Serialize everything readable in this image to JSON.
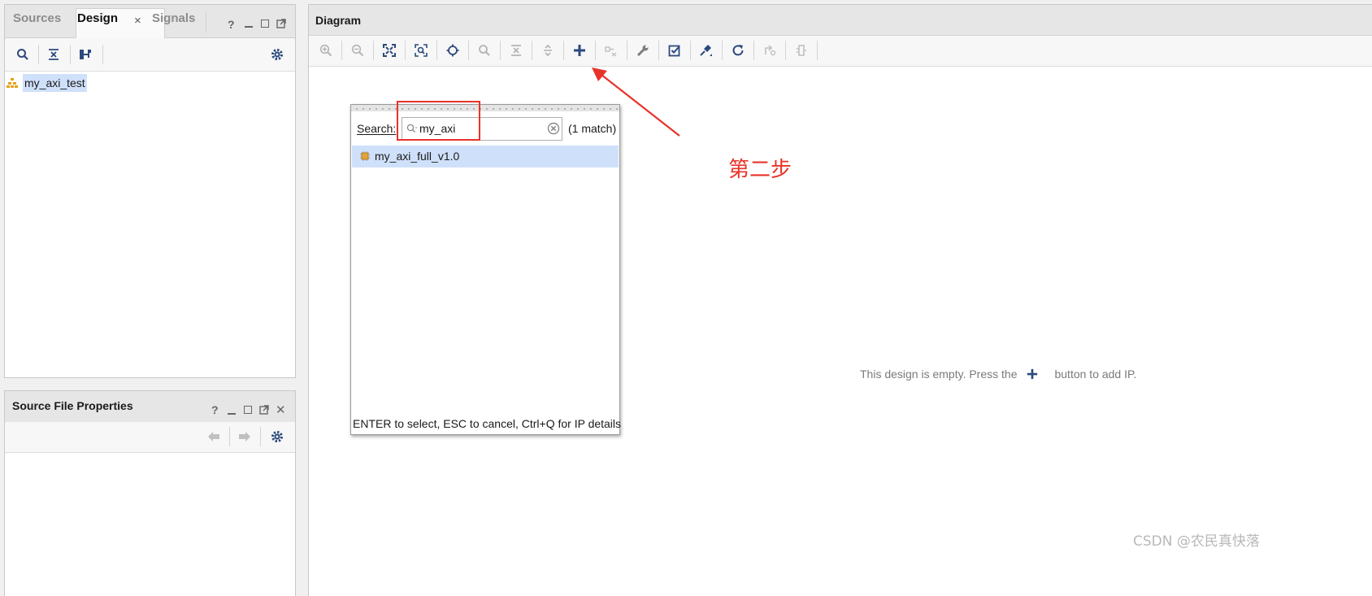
{
  "left_panel": {
    "tabs": [
      {
        "label": "Sources"
      },
      {
        "label": "Design"
      },
      {
        "label": "Signals"
      }
    ],
    "tab_close": "×",
    "controls": {
      "help": "?"
    },
    "tree": {
      "items": [
        {
          "label": "my_axi_test",
          "icon": "hierarchy-icon"
        }
      ]
    }
  },
  "props_panel": {
    "title": "Source File Properties",
    "controls": {
      "help": "?",
      "close": "✕"
    }
  },
  "diagram": {
    "title": "Diagram",
    "empty_message_before": "This design is empty. Press the",
    "empty_message_after": "button to add IP.",
    "toolbar_icons": [
      "zoom-in-icon",
      "zoom-out-icon",
      "fit-icon",
      "zoom-area-icon",
      "center-icon",
      "search-icon",
      "collapse-icon",
      "expand-icon",
      "add-ip-icon",
      "disabled-route-icon",
      "wrench-icon",
      "validate-icon",
      "pin-icon",
      "refresh-icon",
      "disabled-opt-icon",
      "disabled-block-icon"
    ]
  },
  "ip_search_popup": {
    "search_label": "Search:",
    "search_value": "my_axi",
    "match_count": "(1 match)",
    "results": [
      {
        "label": "my_axi_full_v1.0"
      }
    ],
    "footer": "ENTER to select, ESC to cancel, Ctrl+Q for IP details"
  },
  "annotation": {
    "step_label": "第二步",
    "color": "#e8332a"
  },
  "watermark": "CSDN @农民真快落",
  "colors": {
    "icon_blue": "#2c4a7e",
    "selection": "#cfe0fa",
    "accent_red": "#e8332a"
  }
}
